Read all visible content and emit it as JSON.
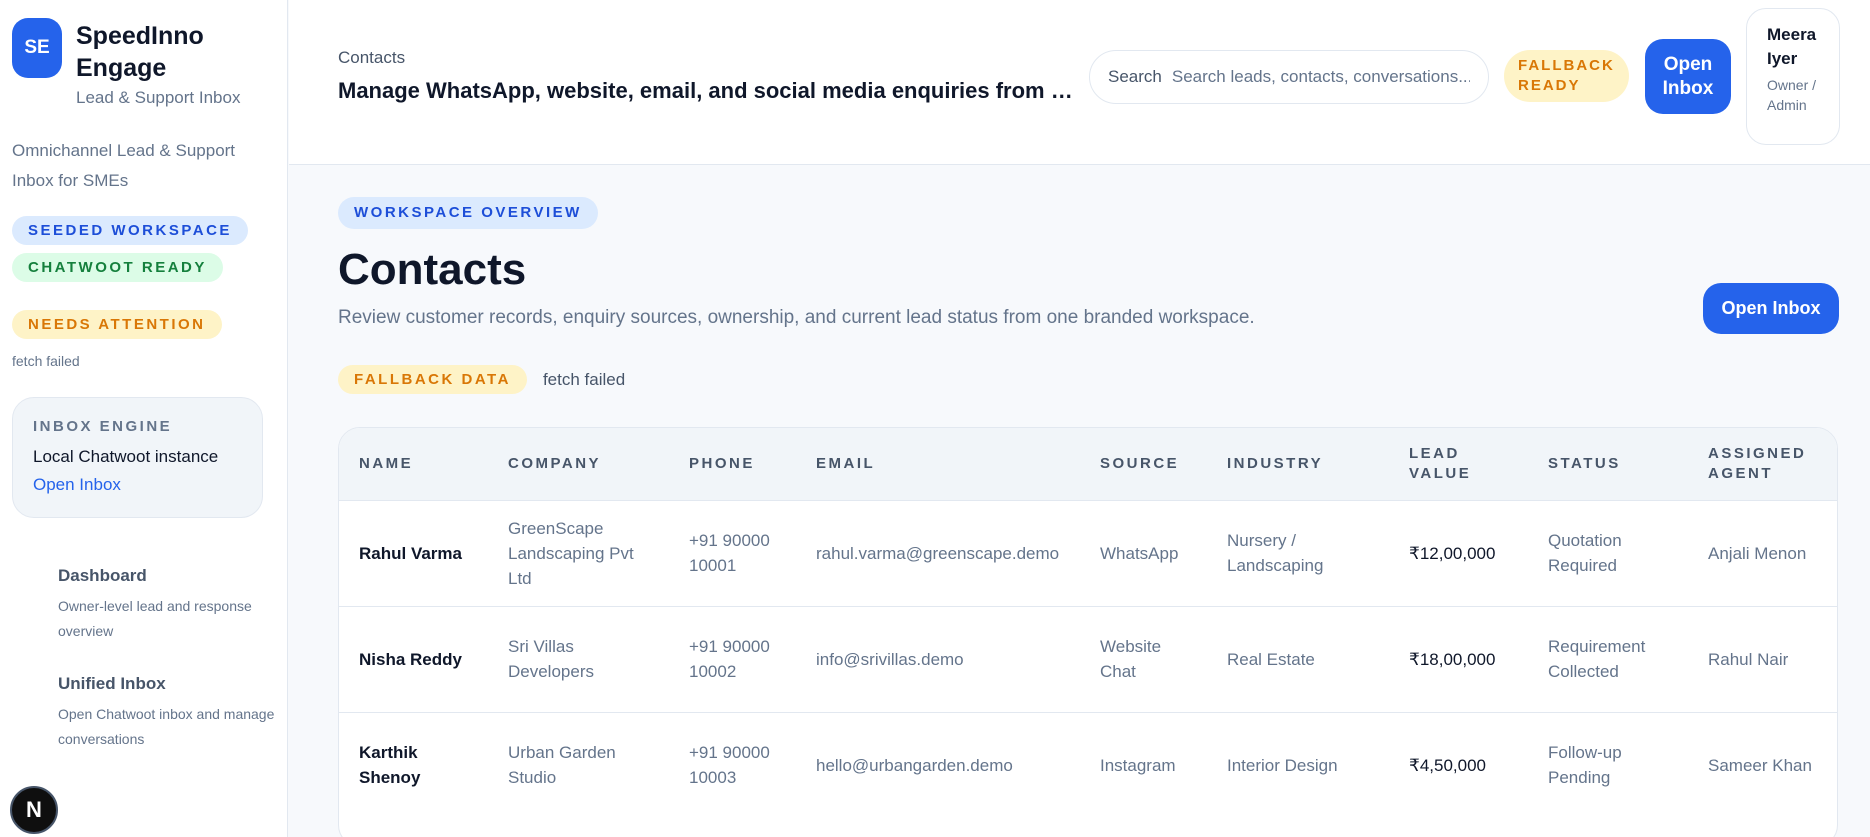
{
  "brand": {
    "logo": "SE",
    "name": "SpeedInno Engage",
    "subtitle": "Lead & Support Inbox",
    "tagline": "Omnichannel Lead & Support Inbox for SMEs"
  },
  "sidebar": {
    "badges": {
      "seeded": "SEEDED WORKSPACE",
      "chatwoot": "CHATWOOT READY",
      "attention": "NEEDS ATTENTION"
    },
    "status": "fetch failed",
    "engine": {
      "title": "INBOX ENGINE",
      "name": "Local Chatwoot instance",
      "link": "Open Inbox"
    },
    "nav": [
      {
        "title": "Dashboard",
        "desc": "Owner-level lead and response overview"
      },
      {
        "title": "Unified Inbox",
        "desc": "Open Chatwoot inbox and manage conversations"
      }
    ],
    "fab": "N"
  },
  "topbar": {
    "breadcrumb": "Contacts",
    "heading": "Manage WhatsApp, website, email, and social media enquiries from one place",
    "search_label": "Search",
    "search_placeholder": "Search leads, contacts, conversations...",
    "fallback_badge": "FALLBACK READY",
    "open_inbox": "Open Inbox",
    "user": {
      "name": "Meera Iyer",
      "role": "Owner / Admin"
    }
  },
  "main": {
    "section_badge": "WORKSPACE OVERVIEW",
    "title": "Contacts",
    "description": "Review customer records, enquiry sources, ownership, and current lead status from one branded workspace.",
    "open_inbox": "Open Inbox",
    "fallback_badge": "FALLBACK DATA",
    "fallback_status": "fetch failed"
  },
  "table": {
    "columns": [
      "NAME",
      "COMPANY",
      "PHONE",
      "EMAIL",
      "SOURCE",
      "INDUSTRY",
      "LEAD VALUE",
      "STATUS",
      "ASSIGNED AGENT"
    ],
    "rows": [
      {
        "name": "Rahul Varma",
        "company": "GreenScape Landscaping Pvt Ltd",
        "phone": "+91 90000 10001",
        "email": "rahul.varma@greenscape.demo",
        "source": "WhatsApp",
        "industry": "Nursery / Landscaping",
        "value": "₹12,00,000",
        "status": "Quotation Required",
        "agent": "Anjali Menon"
      },
      {
        "name": "Nisha Reddy",
        "company": "Sri Villas Developers",
        "phone": "+91 90000 10002",
        "email": "info@srivillas.demo",
        "source": "Website Chat",
        "industry": "Real Estate",
        "value": "₹18,00,000",
        "status": "Requirement Collected",
        "agent": "Rahul Nair"
      },
      {
        "name": "Karthik Shenoy",
        "company": "Urban Garden Studio",
        "phone": "+91 90000 10003",
        "email": "hello@urbangarden.demo",
        "source": "Instagram",
        "industry": "Interior Design",
        "value": "₹4,50,000",
        "status": "Follow-up Pending",
        "agent": "Sameer Khan"
      }
    ]
  }
}
